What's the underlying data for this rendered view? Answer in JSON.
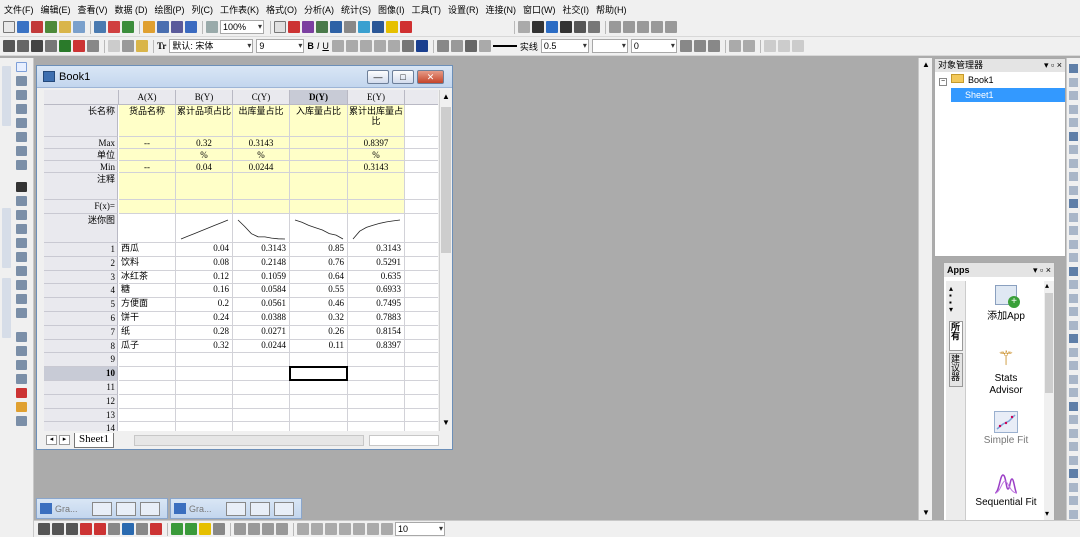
{
  "menubar": [
    "文件(F)",
    "编辑(E)",
    "查看(V)",
    "数据 (D)",
    "绘图(P)",
    "列(C)",
    "工作表(K)",
    "格式(O)",
    "分析(A)",
    "统计(S)",
    "图像(I)",
    "工具(T)",
    "设置(R)",
    "连接(N)",
    "窗口(W)",
    "社交(I)",
    "帮助(H)"
  ],
  "toolbar1": {
    "zoom": "100%"
  },
  "toolbar2": {
    "font_prefix": "Tr",
    "font": "默认: 宋体",
    "font_size": "9",
    "bold": "B",
    "italic": "I",
    "underline": "U",
    "line_style": "实线",
    "line_width": "0.5",
    "angle": "0"
  },
  "toolbar3": {
    "font_size_combo": "10"
  },
  "book": {
    "title": "Book1",
    "btn_minimize": "—",
    "btn_restore": "□",
    "btn_close": "✕",
    "columns": [
      {
        "key": "A",
        "label": "A(X)"
      },
      {
        "key": "B",
        "label": "B(Y)"
      },
      {
        "key": "C",
        "label": "C(Y)"
      },
      {
        "key": "D",
        "label": "D(Y)"
      },
      {
        "key": "E",
        "label": "E(Y)"
      }
    ],
    "meta_labels": {
      "longname": "长名称",
      "units": "单位",
      "max": "Max",
      "min": "Min",
      "comments": "注释",
      "fx": "F(x)=",
      "sparklines": "迷你图"
    },
    "longnames": [
      "货品名称",
      "累计品项占比",
      "出库量占比",
      "入库量占比",
      "累计出库量占比"
    ],
    "max": [
      "--",
      "0.32",
      "0.3143",
      "",
      "0.8397"
    ],
    "units": [
      "",
      "%",
      "%",
      "",
      "%"
    ],
    "min": [
      "--",
      "0.04",
      "0.0244",
      "",
      "0.3143"
    ],
    "rows": [
      {
        "n": "1",
        "cells": [
          "西瓜",
          "0.04",
          "0.3143",
          "0.85",
          "0.3143"
        ]
      },
      {
        "n": "2",
        "cells": [
          "饮料",
          "0.08",
          "0.2148",
          "0.76",
          "0.5291"
        ]
      },
      {
        "n": "3",
        "cells": [
          "冰红茶",
          "0.12",
          "0.1059",
          "0.64",
          "0.635"
        ]
      },
      {
        "n": "4",
        "cells": [
          "糖",
          "0.16",
          "0.0584",
          "0.55",
          "0.6933"
        ]
      },
      {
        "n": "5",
        "cells": [
          "方便面",
          "0.2",
          "0.0561",
          "0.46",
          "0.7495"
        ]
      },
      {
        "n": "6",
        "cells": [
          "饼干",
          "0.24",
          "0.0388",
          "0.32",
          "0.7883"
        ]
      },
      {
        "n": "7",
        "cells": [
          "纸",
          "0.28",
          "0.0271",
          "0.26",
          "0.8154"
        ]
      },
      {
        "n": "8",
        "cells": [
          "瓜子",
          "0.32",
          "0.0244",
          "0.11",
          "0.8397"
        ]
      },
      {
        "n": "9",
        "cells": [
          "",
          "",
          "",
          "",
          ""
        ]
      },
      {
        "n": "10",
        "cells": [
          "",
          "",
          "",
          "",
          ""
        ]
      },
      {
        "n": "11",
        "cells": [
          "",
          "",
          "",
          "",
          ""
        ]
      },
      {
        "n": "12",
        "cells": [
          "",
          "",
          "",
          "",
          ""
        ]
      },
      {
        "n": "13",
        "cells": [
          "",
          "",
          "",
          "",
          ""
        ]
      },
      {
        "n": "14",
        "cells": [
          "",
          "",
          "",
          "",
          ""
        ]
      }
    ],
    "sheet_tab": "Sheet1",
    "active_row": "10",
    "active_col": "D"
  },
  "minimized_windows": [
    {
      "title": "Gra..."
    },
    {
      "title": "Gra..."
    }
  ],
  "object_manager": {
    "title": "对象管理器",
    "book": "Book1",
    "sheet": "Sheet1"
  },
  "apps": {
    "title": "Apps",
    "tabs": [
      "所有",
      "建议器"
    ],
    "items": [
      {
        "label": "添加App"
      },
      {
        "label": "Stats Advisor"
      },
      {
        "label": "Simple Fit"
      },
      {
        "label": "Sequential Fit"
      }
    ]
  },
  "colors": {
    "accent": "#3399ff",
    "meta_fill": "#ffffc8",
    "workspace": "#ababab"
  }
}
